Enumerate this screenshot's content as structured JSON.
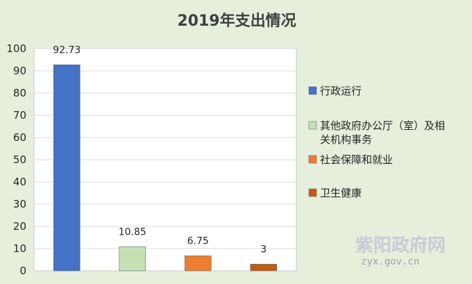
{
  "chart_data": {
    "type": "bar",
    "title": "2019年支出情况",
    "categories": [
      "行政运行",
      "其他政府办公厅（室）及相关机构事务",
      "社会保障和就业",
      "卫生健康"
    ],
    "values": [
      92.73,
      10.85,
      6.75,
      3
    ],
    "data_labels": [
      "92.73",
      "10.85",
      "6.75",
      "3"
    ],
    "colors": [
      "#4472c4",
      "#c5e0b4",
      "#ed7d31",
      "#c55a11"
    ],
    "ylim": [
      0,
      100
    ],
    "yticks": [
      0,
      10,
      20,
      30,
      40,
      50,
      60,
      70,
      80,
      90,
      100
    ],
    "grid": true,
    "legend_position": "right",
    "legend": [
      {
        "lines": [
          "行政运行"
        ]
      },
      {
        "lines": [
          "其他政府办公厅（室）及相",
          "关机构事务"
        ]
      },
      {
        "lines": [
          "社会保障和就业"
        ]
      },
      {
        "lines": [
          "卫生健康"
        ]
      }
    ]
  },
  "watermark": {
    "text": "紫阳政府网",
    "url": "zyx.gov.cn"
  }
}
